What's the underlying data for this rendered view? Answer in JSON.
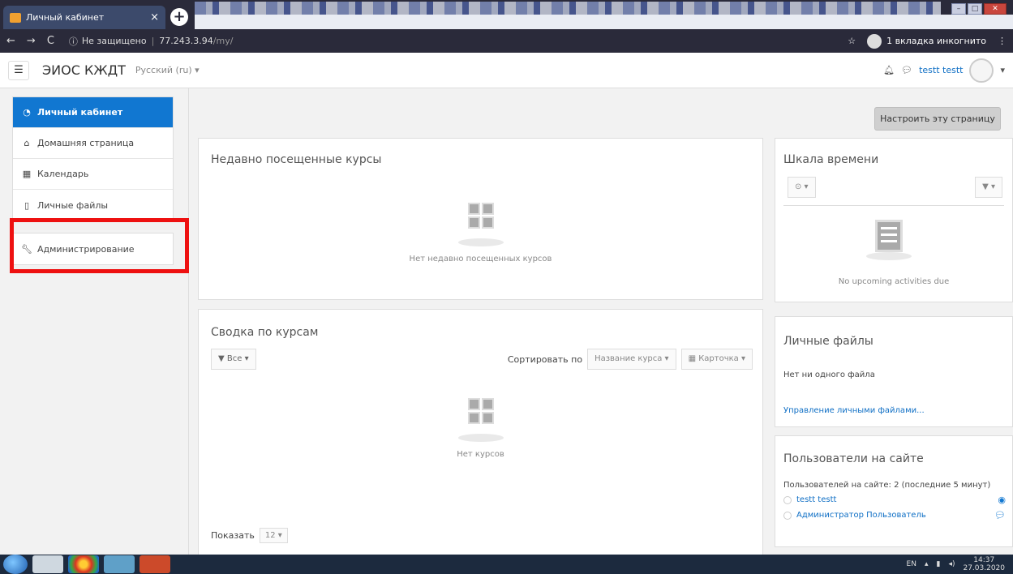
{
  "browser": {
    "tab_title": "Личный кабинет",
    "tab_close": "×",
    "new_tab": "+",
    "not_secure": "Не защищено",
    "url_host": "77.243.3.94",
    "url_path": "/my/",
    "incognito_label": "1 вкладка инкогнито"
  },
  "navbar": {
    "brand": "ЭИОС КЖДТ",
    "language": "Русский (ru) ▾",
    "user_name": "testt testt"
  },
  "drawer": {
    "items": [
      {
        "label": "Личный кабинет",
        "icon": "dashboard-icon"
      },
      {
        "label": "Домашняя страница",
        "icon": "home-icon"
      },
      {
        "label": "Календарь",
        "icon": "calendar-icon"
      },
      {
        "label": "Личные файлы",
        "icon": "file-icon"
      }
    ],
    "admin": {
      "label": "Администрирование",
      "icon": "wrench-icon"
    },
    "highlight_color": "#ee1111"
  },
  "main": {
    "customize_button": "Настроить эту страницу",
    "recent": {
      "title": "Недавно посещенные курсы",
      "empty": "Нет недавно посещенных курсов"
    },
    "overview": {
      "title": "Сводка по курсам",
      "filter": "Все ▾",
      "sort_label": "Сортировать по",
      "sort_value": "Название курса ▾",
      "view_value": "Карточка ▾",
      "empty": "Нет курсов",
      "show_label": "Показать",
      "show_value": "12 ▾"
    },
    "timeline": {
      "title": "Шкала времени",
      "time_filter": "⊙ ▾",
      "sort_filter": "▼ ▾",
      "empty": "No upcoming activities due"
    },
    "files": {
      "title": "Личные файлы",
      "none": "Нет ни одного файла",
      "manage": "Управление личными файлами..."
    },
    "online": {
      "title": "Пользователи на сайте",
      "stat": "Пользователей на сайте: 2 (последние 5 минут)",
      "users": [
        "testt testt",
        "Администратор Пользователь"
      ]
    }
  },
  "taskbar": {
    "lang": "EN",
    "time": "14:37",
    "date": "27.03.2020"
  },
  "colors": {
    "primary": "#1177d1",
    "link": "#0f6fc5"
  }
}
